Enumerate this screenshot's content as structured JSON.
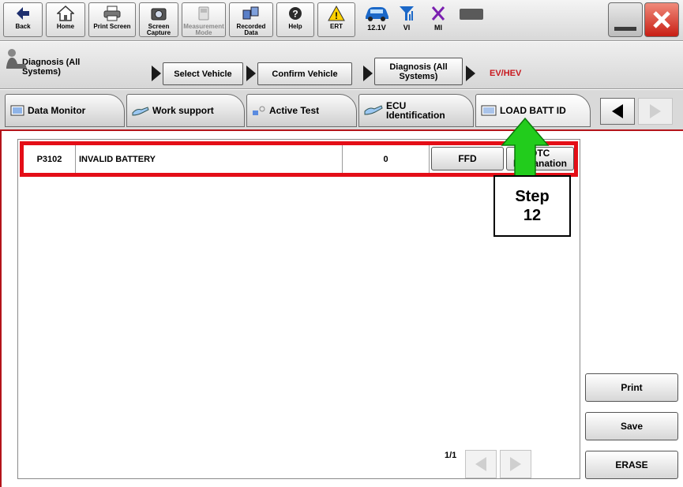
{
  "toolbar": {
    "back": "Back",
    "home": "Home",
    "print_screen": "Print Screen",
    "screen_capture": "Screen\nCapture",
    "measurement_mode": "Measurement\nMode",
    "recorded_data": "Recorded\nData",
    "help": "Help",
    "ert": "ERT",
    "voltage": "12.1V",
    "vi": "VI",
    "mi": "MI"
  },
  "breadcrumb": {
    "first": "Diagnosis (All\nSystems)",
    "select_vehicle": "Select Vehicle",
    "confirm_vehicle": "Confirm Vehicle",
    "diagnosis_all": "Diagnosis (All\nSystems)",
    "system": "EV/HEV"
  },
  "tabs": {
    "data_monitor": "Data Monitor",
    "work_support": "Work support",
    "active_test": "Active Test",
    "ecu_identification": "ECU\nIdentification",
    "load_batt_id": "LOAD BATT ID"
  },
  "dtc": {
    "code": "P3102",
    "description": "INVALID BATTERY",
    "count": "0",
    "ffd_label": "FFD",
    "explanation_label": "DTC\nExplanation"
  },
  "side": {
    "print": "Print",
    "save": "Save",
    "erase": "ERASE"
  },
  "pager": {
    "page": "1/1"
  },
  "annotation": {
    "step_label": "Step\n12",
    "arrow_color": "#22cc1c"
  },
  "colors": {
    "highlight_red": "#e40e17",
    "system_red": "#c8181e"
  }
}
